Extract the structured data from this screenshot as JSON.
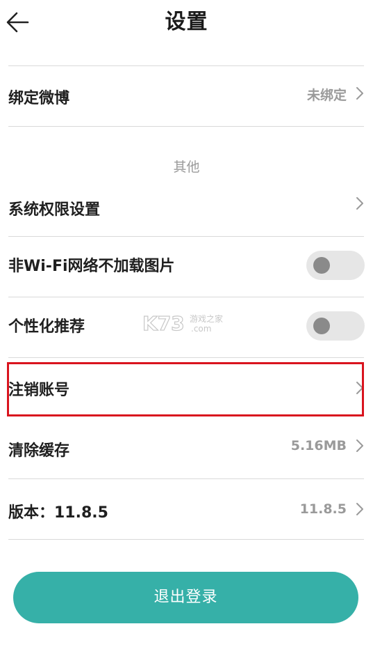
{
  "header": {
    "title": "设置",
    "back_icon": "arrow-left-icon"
  },
  "rows": {
    "weibo": {
      "label": "绑定微博",
      "value": "未绑定"
    },
    "section_other": "其他",
    "permissions": {
      "label": "系统权限设置"
    },
    "no_wifi_images": {
      "label": "非Wi-Fi网络不加载图片",
      "toggle_on": false
    },
    "personalized": {
      "label": "个性化推荐",
      "toggle_on": false
    },
    "cancel_account": {
      "label": "注销账号"
    },
    "clear_cache": {
      "label": "清除缓存",
      "value": "5.16MB"
    },
    "version": {
      "label": "版本：11.8.5",
      "value": "11.8.5"
    }
  },
  "logout": {
    "label": "退出登录"
  },
  "watermark": {
    "brand": "K73",
    "text": "游戏之家",
    "domain": ".com"
  },
  "colors": {
    "accent": "#36b0a8",
    "highlight": "#d9141e",
    "secondary_text": "#9a9a9a",
    "divider": "#d9d9d9"
  }
}
